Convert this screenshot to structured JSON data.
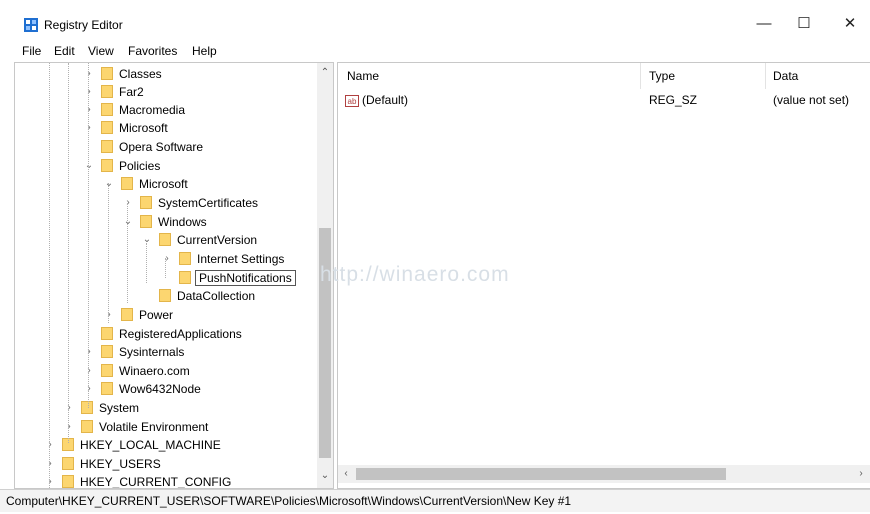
{
  "window": {
    "title": "Registry Editor",
    "minimize_glyph": "—",
    "maximize_glyph": "☐",
    "close_glyph": "✕"
  },
  "menu": [
    "File",
    "Edit",
    "View",
    "Favorites",
    "Help"
  ],
  "tree": {
    "items": [
      {
        "label": "Classes",
        "expander": "›"
      },
      {
        "label": "Far2",
        "expander": "›"
      },
      {
        "label": "Macromedia",
        "expander": "›"
      },
      {
        "label": "Microsoft",
        "expander": "›"
      },
      {
        "label": "Opera Software",
        "expander": ""
      },
      {
        "label": "Policies",
        "expander": "⌄"
      },
      {
        "label": "Microsoft",
        "expander": "⌄"
      },
      {
        "label": "SystemCertificates",
        "expander": "›"
      },
      {
        "label": "Windows",
        "expander": "⌄"
      },
      {
        "label": "CurrentVersion",
        "expander": "⌄"
      },
      {
        "label": "Internet Settings",
        "expander": "›"
      },
      {
        "label": "PushNotifications",
        "expander": ""
      },
      {
        "label": "DataCollection",
        "expander": ""
      },
      {
        "label": "Power",
        "expander": "›"
      },
      {
        "label": "RegisteredApplications",
        "expander": ""
      },
      {
        "label": "Sysinternals",
        "expander": "›"
      },
      {
        "label": "Winaero.com",
        "expander": "›"
      },
      {
        "label": "Wow6432Node",
        "expander": "›"
      },
      {
        "label": "System",
        "expander": "›"
      },
      {
        "label": "Volatile Environment",
        "expander": "›"
      },
      {
        "label": "HKEY_LOCAL_MACHINE",
        "expander": "›"
      },
      {
        "label": "HKEY_USERS",
        "expander": "›"
      },
      {
        "label": "HKEY_CURRENT_CONFIG",
        "expander": "›"
      }
    ]
  },
  "list": {
    "columns": [
      "Name",
      "Type",
      "Data"
    ],
    "rows": [
      {
        "icon": "ab",
        "name": "(Default)",
        "type": "REG_SZ",
        "data": "(value not set)"
      }
    ]
  },
  "watermark": "http://winaero.com",
  "status": "Computer\\HKEY_CURRENT_USER\\SOFTWARE\\Policies\\Microsoft\\Windows\\CurrentVersion\\New Key #1",
  "colors": {
    "folder": "#fcd670",
    "app_icon": "#1f6fd1"
  }
}
